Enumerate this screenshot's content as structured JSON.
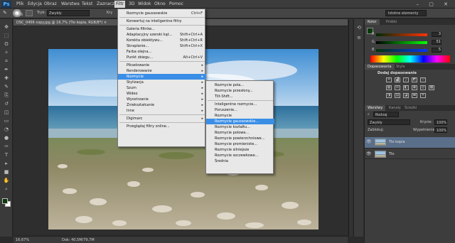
{
  "app": {
    "logo": "Ps"
  },
  "menubar": {
    "items": [
      "Plik",
      "Edycja",
      "Obraz",
      "Warstwa",
      "Tekst",
      "Zaznacz",
      "Filtr",
      "3D",
      "Widok",
      "Okno",
      "Pomoc"
    ],
    "active": "Filtr",
    "window_controls": "– ▢ ✕"
  },
  "options": {
    "size": "1200",
    "mode_label": "Tryb:",
    "mode_value": "Zwykły",
    "kry_label": "Kry",
    "workspace": "Istotne elementy"
  },
  "document": {
    "tab_title": "DSC_0456 copy.jpg @ 16,7% (Tło kopia, RGB/8*) ×",
    "zoom": "16,67%",
    "doc_info": "Dok: 40,5M/79,7M"
  },
  "filter_menu": {
    "items": [
      {
        "label": "Rozmycie gaussowskie",
        "shortcut": "Ctrl+F"
      },
      {
        "sep": true
      },
      {
        "label": "Konwertuj na inteligentne filtry"
      },
      {
        "sep": true
      },
      {
        "label": "Galeria filtrów..."
      },
      {
        "label": "Adaptacyjny szeroki kąt...",
        "shortcut": "Shift+Ctrl+A"
      },
      {
        "label": "Korekta obiektywu...",
        "shortcut": "Shift+Ctrl+R"
      },
      {
        "label": "Skraplanie...",
        "shortcut": "Shift+Ctrl+X"
      },
      {
        "label": "Farba olejna..."
      },
      {
        "label": "Punkt zbiegu...",
        "shortcut": "Alt+Ctrl+V"
      },
      {
        "sep": true
      },
      {
        "label": "Pikselowanie",
        "submenu": true
      },
      {
        "label": "Renderowanie",
        "submenu": true
      },
      {
        "label": "Rozmycie",
        "submenu": true,
        "highlighted": true
      },
      {
        "label": "Stylizacja",
        "submenu": true
      },
      {
        "label": "Szum",
        "submenu": true
      },
      {
        "label": "Wideo",
        "submenu": true
      },
      {
        "label": "Wyostrzanie",
        "submenu": true
      },
      {
        "label": "Zniekształcanie",
        "submenu": true
      },
      {
        "label": "Inne",
        "submenu": true
      },
      {
        "sep": true
      },
      {
        "label": "Digimarc",
        "submenu": true
      },
      {
        "sep": true
      },
      {
        "label": "Przeglądaj filtry online..."
      }
    ]
  },
  "blur_menu": {
    "items": [
      {
        "label": "Rozmycie pola..."
      },
      {
        "label": "Rozmycie przesłony..."
      },
      {
        "label": "Tilt-Shift..."
      },
      {
        "sep": true
      },
      {
        "label": "Inteligentne rozmycie..."
      },
      {
        "label": "Poruszenie..."
      },
      {
        "label": "Rozmycie"
      },
      {
        "label": "Rozmycie gaussowskie...",
        "highlighted": true
      },
      {
        "label": "Rozmycie kształtu..."
      },
      {
        "label": "Rozmycie polowe..."
      },
      {
        "label": "Rozmycie powierzchniowe..."
      },
      {
        "label": "Rozmycie promieniste..."
      },
      {
        "label": "Rozmycie silniejsze"
      },
      {
        "label": "Rozmycie soczewkowe..."
      },
      {
        "label": "Średnia"
      }
    ]
  },
  "color_panel": {
    "tabs": [
      "Kolor",
      "Próbki"
    ],
    "sliders": [
      {
        "label": "R",
        "value": "3",
        "color": "#e03030"
      },
      {
        "label": "G",
        "value": "51",
        "color": "#30c030"
      },
      {
        "label": "B",
        "value": "5",
        "color": "#3050e0"
      }
    ]
  },
  "adjust_panel": {
    "tabs": [
      "Dopasowania",
      "Style"
    ],
    "title": "Dodaj dopasowanie"
  },
  "layers_panel": {
    "tabs": [
      "Warstwy",
      "Kanały",
      "Ścieżki"
    ],
    "kind_label": "Rodzaj",
    "blend_mode": "Zwykły",
    "opacity_label": "Krycie:",
    "opacity_value": "100%",
    "lock_label": "Zablokuj:",
    "fill_label": "Wypełnienie:",
    "fill_value": "100%",
    "layers": [
      {
        "name": "Tło kopia",
        "selected": true
      },
      {
        "name": "Tło",
        "selected": false
      }
    ]
  },
  "tools": [
    "move-icon",
    "marquee-icon",
    "lasso-icon",
    "quick-select-icon",
    "crop-icon",
    "eyedropper-icon",
    "healing-icon",
    "brush-icon",
    "stamp-icon",
    "history-brush-icon",
    "eraser-icon",
    "gradient-icon",
    "blur-icon",
    "dodge-icon",
    "pen-icon",
    "type-icon",
    "path-select-icon",
    "shape-icon",
    "hand-icon",
    "zoom-icon"
  ],
  "colors": {
    "menu_highlight": "#3b8ee6",
    "layer_selected": "#5a6f8a"
  }
}
